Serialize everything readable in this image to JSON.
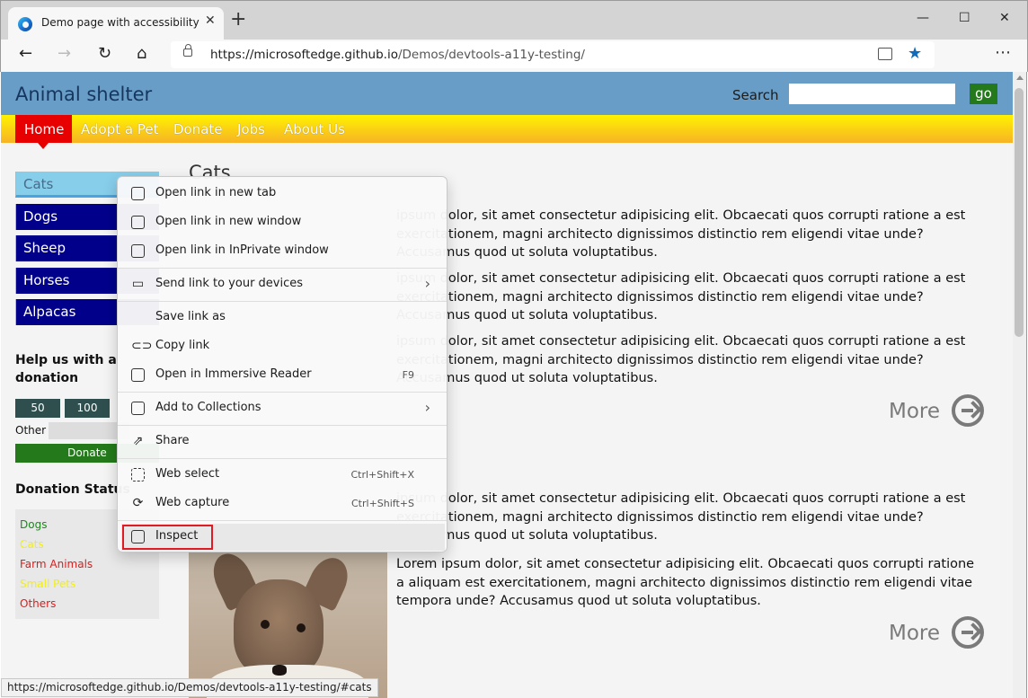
{
  "browser": {
    "tab_title": "Demo page with accessibility issues",
    "tab_close": "✕",
    "new_tab": "+",
    "window_controls": {
      "minimize": "—",
      "maximize": "☐",
      "close": "✕"
    },
    "nav": {
      "back": "←",
      "forward": "→",
      "refresh": "↻",
      "home": "⌂"
    },
    "url_host": "https://microsoftedge.github.io",
    "url_path": "/Demos/devtools-a11y-testing/",
    "more": "⋯",
    "favorite": "★",
    "status_url": "https://microsoftedge.github.io/Demos/devtools-a11y-testing/#cats"
  },
  "page": {
    "site_title": "Animal shelter",
    "search_label": "Search",
    "go_label": "go",
    "nav": [
      "Home",
      "Adopt a Pet",
      "Donate",
      "Jobs",
      "About Us"
    ],
    "sidenav": [
      "Cats",
      "Dogs",
      "Sheep",
      "Horses",
      "Alpacas"
    ],
    "help_heading": "Help us with a donation",
    "amounts": [
      "50",
      "100"
    ],
    "other_label": "Other",
    "donate_label": "Donate",
    "status_heading": "Donation Status",
    "status_items": [
      {
        "label": "Dogs",
        "color": "#1a8a1a"
      },
      {
        "label": "Cats",
        "color": "#f4f000"
      },
      {
        "label": "Farm Animals",
        "color": "#e01b1b"
      },
      {
        "label": "Small Pets",
        "color": "#f4f000"
      },
      {
        "label": "Others",
        "color": "#e01b1b"
      }
    ],
    "content_heading": "Cats",
    "paragraphs": [
      "ipsum dolor, sit amet consectetur adipisicing elit. Obcaecati quos corrupti ratione a est exercitationem, magni architecto dignissimos distinctio rem eligendi vitae unde? Accusamus quod ut soluta voluptatibus.",
      "ipsum dolor, sit amet consectetur adipisicing elit. Obcaecati quos corrupti ratione a est exercitationem, magni architecto dignissimos distinctio rem eligendi vitae unde? Accusamus quod ut soluta voluptatibus.",
      "ipsum dolor, sit amet consectetur adipisicing elit. Obcaecati quos corrupti ratione a est exercitationem, magni architecto dignissimos distinctio rem eligendi vitae unde? Accusamus quod ut soluta voluptatibus.",
      "ipsum dolor, sit amet consectetur adipisicing elit. Obcaecati quos corrupti ratione a est exercitationem, magni architecto dignissimos distinctio rem eligendi vitae unde? Accusamus quod ut soluta voluptatibus.",
      "Lorem ipsum dolor, sit amet consectetur adipisicing elit. Obcaecati quos corrupti ratione a aliquam est exercitationem, magni architecto dignissimos distinctio rem eligendi vitae tempora unde? Accusamus quod ut soluta voluptatibus."
    ],
    "more_label": "More"
  },
  "context_menu": {
    "items": [
      {
        "label": "Open link in new tab",
        "icon": "new-tab-icon",
        "shortcut": "",
        "submenu": false
      },
      {
        "label": "Open link in new window",
        "icon": "new-window-icon",
        "shortcut": "",
        "submenu": false
      },
      {
        "label": "Open link in InPrivate window",
        "icon": "inprivate-icon",
        "shortcut": "",
        "submenu": false
      },
      {
        "label": "Send link to your devices",
        "icon": "devices-icon",
        "shortcut": "",
        "submenu": true
      },
      {
        "label": "Save link as",
        "icon": "",
        "shortcut": "",
        "submenu": false
      },
      {
        "label": "Copy link",
        "icon": "link-icon",
        "shortcut": "",
        "submenu": false
      },
      {
        "label": "Open in Immersive Reader",
        "icon": "immersive-reader-icon",
        "shortcut": "F9",
        "submenu": false
      },
      {
        "label": "Add to Collections",
        "icon": "collections-icon",
        "shortcut": "",
        "submenu": true
      },
      {
        "label": "Share",
        "icon": "share-icon",
        "shortcut": "",
        "submenu": false
      },
      {
        "label": "Web select",
        "icon": "web-select-icon",
        "shortcut": "Ctrl+Shift+X",
        "submenu": false
      },
      {
        "label": "Web capture",
        "icon": "web-capture-icon",
        "shortcut": "Ctrl+Shift+S",
        "submenu": false
      },
      {
        "label": "Inspect",
        "icon": "inspect-icon",
        "shortcut": "",
        "submenu": false
      }
    ],
    "highlighted": "Inspect",
    "submenu_arrow": "›"
  },
  "colors": {
    "header_bg": "#689dc8",
    "nav_active": "#e80000",
    "sidenav_bg": "#00008b",
    "accent_green": "#247a1b",
    "highlight_outline": "#e01b24"
  }
}
